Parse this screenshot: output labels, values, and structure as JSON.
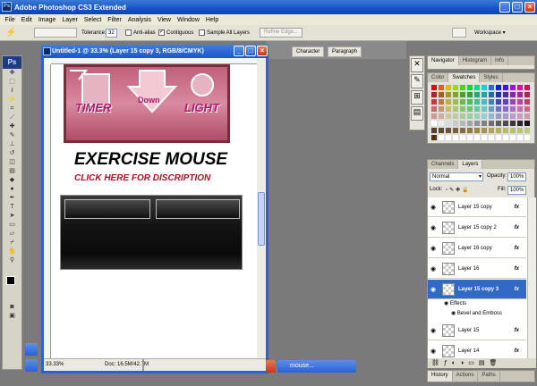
{
  "app": {
    "title": "Adobe Photoshop CS3 Extended",
    "logo": "Ps"
  },
  "menu": [
    "File",
    "Edit",
    "Image",
    "Layer",
    "Select",
    "Filter",
    "Analysis",
    "View",
    "Window",
    "Help"
  ],
  "options": {
    "tolerance_label": "Tolerance:",
    "tolerance_value": "32",
    "anti_alias": "Anti-alias",
    "contiguous": "Contiguous",
    "sample_all": "Sample All Layers",
    "refine_edge": "Refine Edge...",
    "workspace": "Workspace"
  },
  "dock_tabs": [
    "Character",
    "Paragraph"
  ],
  "document": {
    "title": "Untitled-1 @ 33.3% (Layer 15 copy 3, RGB/8/CMYK)",
    "zoom": "33.33%",
    "doc_size": "Doc: 16.5M/42.7M",
    "timer_word1": "TIMER",
    "timer_word2": "Down",
    "timer_word3": "LIGHT",
    "headline": "EXERCISE MOUSE",
    "subline": "CLICK HERE FOR DISCRIPTION"
  },
  "nav_tabs": [
    "Navigator",
    "Histogram",
    "Info"
  ],
  "color_tabs": [
    "Color",
    "Swatches",
    "Styles"
  ],
  "layers_tabs": [
    "Channels",
    "Layers"
  ],
  "layers": {
    "blend_mode": "Normal",
    "opacity_label": "Opacity:",
    "opacity_value": "100%",
    "lock_label": "Lock:",
    "fill_label": "Fill:",
    "fill_value": "100%",
    "items": [
      "Layer 15 copy",
      "Layer 15 copy 2",
      "Layer 16 copy",
      "Layer 16",
      "Layer 15 copy 3",
      "Layer 15",
      "Layer 14"
    ],
    "effects_label": "Effects",
    "effect_item": "Bevel and Emboss"
  },
  "bottom_tabs": [
    "History",
    "Actions",
    "Paths"
  ],
  "mini_window": "mouse...",
  "colors": {
    "titlebar": "#1652c9",
    "selected_layer": "#316ac5",
    "canvas_frame": "#7d2a3c",
    "panel_bg": "#e6e4da"
  }
}
